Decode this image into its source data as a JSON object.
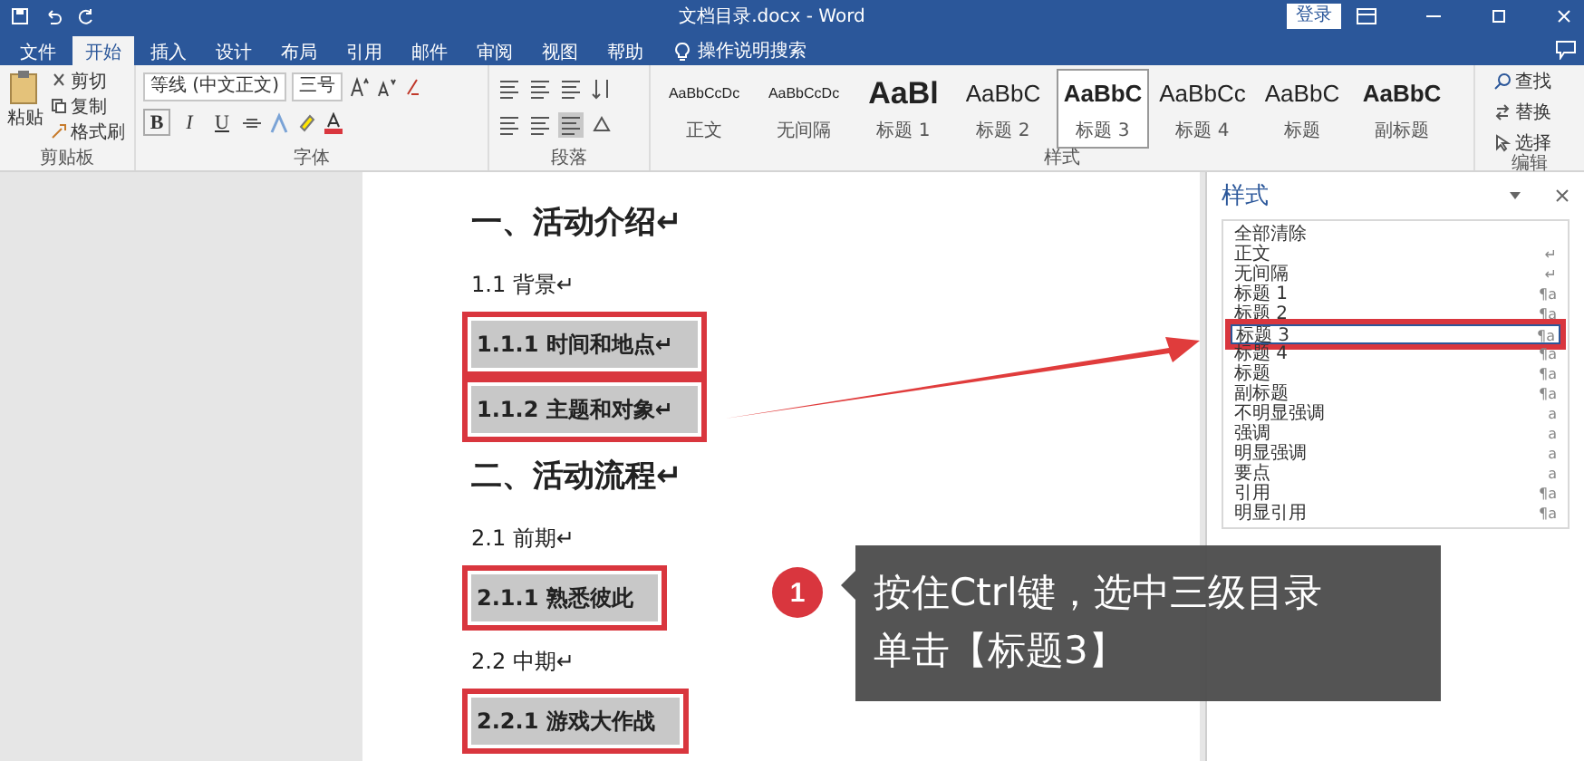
{
  "window": {
    "title": "文档目录.docx - Word",
    "login": "登录"
  },
  "tabs": [
    {
      "label": "文件",
      "selected": false
    },
    {
      "label": "开始",
      "selected": true
    },
    {
      "label": "插入",
      "selected": false
    },
    {
      "label": "设计",
      "selected": false
    },
    {
      "label": "布局",
      "selected": false
    },
    {
      "label": "引用",
      "selected": false
    },
    {
      "label": "邮件",
      "selected": false
    },
    {
      "label": "审阅",
      "selected": false
    },
    {
      "label": "视图",
      "selected": false
    },
    {
      "label": "帮助",
      "selected": false
    }
  ],
  "tell_me": "操作说明搜索",
  "ribbon": {
    "clipboard": {
      "paste": "粘贴",
      "cut": "剪切",
      "copy": "复制",
      "format_painter": "格式刷",
      "label": "剪贴板"
    },
    "font": {
      "name": "等线 (中文正文)",
      "size": "三号",
      "buttons": [
        "B",
        "I",
        "U"
      ],
      "label": "字体"
    },
    "paragraph": {
      "label": "段落"
    },
    "styles": {
      "label": "样式",
      "items": [
        {
          "preview": "AaBbCcDc",
          "name": "正文",
          "kind": "small",
          "selected": false
        },
        {
          "preview": "AaBbCcDc",
          "name": "无间隔",
          "kind": "small",
          "selected": false
        },
        {
          "preview": "AaBl",
          "name": "标题 1",
          "kind": "large",
          "selected": false
        },
        {
          "preview": "AaBbC",
          "name": "标题 2",
          "kind": "medium",
          "selected": false
        },
        {
          "preview": "AaBbC",
          "name": "标题 3",
          "kind": "bold",
          "selected": true
        },
        {
          "preview": "AaBbCc",
          "name": "标题 4",
          "kind": "medium",
          "selected": false
        },
        {
          "preview": "AaBbC",
          "name": "标题",
          "kind": "medium",
          "selected": false
        },
        {
          "preview": "AaBbC",
          "name": "副标题",
          "kind": "bold",
          "selected": false
        }
      ]
    },
    "editing": {
      "find": "查找",
      "replace": "替换",
      "select": "选择",
      "label": "编辑"
    }
  },
  "document": {
    "paragraphs": [
      {
        "kind": "heading1",
        "text": "一、活动介绍↵",
        "selected": false
      },
      {
        "kind": "heading2",
        "text": "1.1 背景↵",
        "selected": false
      },
      {
        "kind": "heading3",
        "text": "1.1.1 时间和地点↵",
        "selected": true
      },
      {
        "kind": "heading3",
        "text": "1.1.2 主题和对象↵",
        "selected": true
      },
      {
        "kind": "heading1",
        "text": "二、活动流程↵",
        "selected": false
      },
      {
        "kind": "heading2",
        "text": "2.1 前期↵",
        "selected": false
      },
      {
        "kind": "heading3",
        "text": "2.1.1 熟悉彼此",
        "selected": true
      },
      {
        "kind": "heading2",
        "text": "2.2 中期↵",
        "selected": false
      },
      {
        "kind": "heading3",
        "text": "2.2.1 游戏大作战",
        "selected": true
      }
    ]
  },
  "styles_pane": {
    "title": "样式",
    "items": [
      {
        "name": "全部清除",
        "selected": false
      },
      {
        "name": "正文",
        "mark": "↵",
        "selected": false
      },
      {
        "name": "无间隔",
        "mark": "↵",
        "selected": false
      },
      {
        "name": "标题 1",
        "mark": "¶a",
        "selected": false
      },
      {
        "name": "标题 2",
        "mark": "¶a",
        "selected": false
      },
      {
        "name": "标题 3",
        "mark": "¶a",
        "selected": true
      },
      {
        "name": "标题 4",
        "mark": "¶a",
        "selected": false
      },
      {
        "name": "标题",
        "mark": "¶a",
        "selected": false
      },
      {
        "name": "副标题",
        "mark": "¶a",
        "selected": false
      },
      {
        "name": "不明显强调",
        "mark": "a",
        "selected": false
      },
      {
        "name": "强调",
        "mark": "a",
        "selected": false
      },
      {
        "name": "明显强调",
        "mark": "a",
        "selected": false
      },
      {
        "name": "要点",
        "mark": "a",
        "selected": false
      },
      {
        "name": "引用",
        "mark": "¶a",
        "selected": false
      },
      {
        "name": "明显引用",
        "mark": "¶a",
        "selected": false
      }
    ]
  },
  "callout": {
    "number": "1",
    "lines": [
      "按住Ctrl键，选中三级目录",
      "单击【标题3】"
    ]
  }
}
